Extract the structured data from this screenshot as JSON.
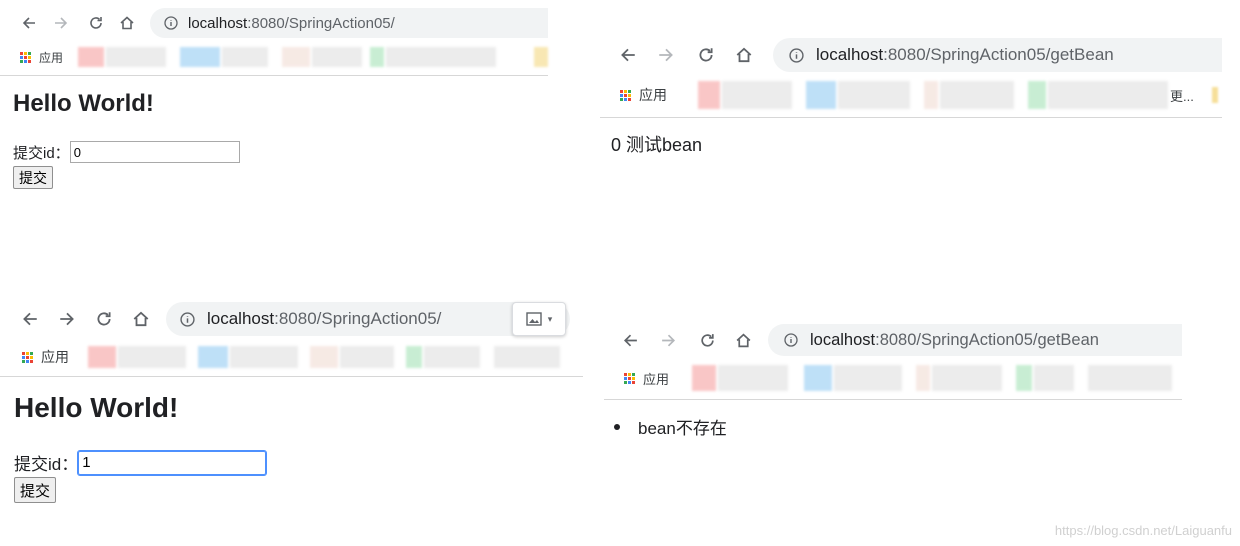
{
  "browser": {
    "host": "localhost",
    "apps_label": "应用",
    "bookmark_overflow": "更..."
  },
  "panels": {
    "top_left": {
      "url_path": ":8080/SpringAction05/",
      "heading": "Hello World!",
      "form_label": "提交id：",
      "input_value": "0",
      "submit_label": "提交"
    },
    "top_right": {
      "url_path": ":8080/SpringAction05/getBean",
      "result_text": "0 测试bean"
    },
    "bottom_left": {
      "url_path": ":8080/SpringAction05/",
      "heading": "Hello World!",
      "form_label": "提交id：",
      "input_value": "1",
      "submit_label": "提交"
    },
    "bottom_right": {
      "url_path": ":8080/SpringAction05/getBean",
      "result_bullet": "bean不存在"
    }
  },
  "watermark": "https://blog.csdn.net/Laiguanfu",
  "colors": {
    "apps_dots": [
      "#ea4335",
      "#fbbc04",
      "#34a853",
      "#4285f4",
      "#ea4335",
      "#fbbc04",
      "#34a853",
      "#4285f4",
      "#ea4335"
    ],
    "blurred_bookmarks": [
      "#f8b4b4",
      "#e6e6e6",
      "#a9d6f5",
      "#e6e6e6",
      "#f4e3dc",
      "#e6e6e6",
      "#b6e8c5",
      "#e6e6e6",
      "#f6df9a"
    ]
  },
  "icons": [
    "back-arrow-icon",
    "forward-arrow-icon",
    "reload-icon",
    "home-icon",
    "info-icon",
    "apps-grid-icon",
    "image-icon"
  ]
}
